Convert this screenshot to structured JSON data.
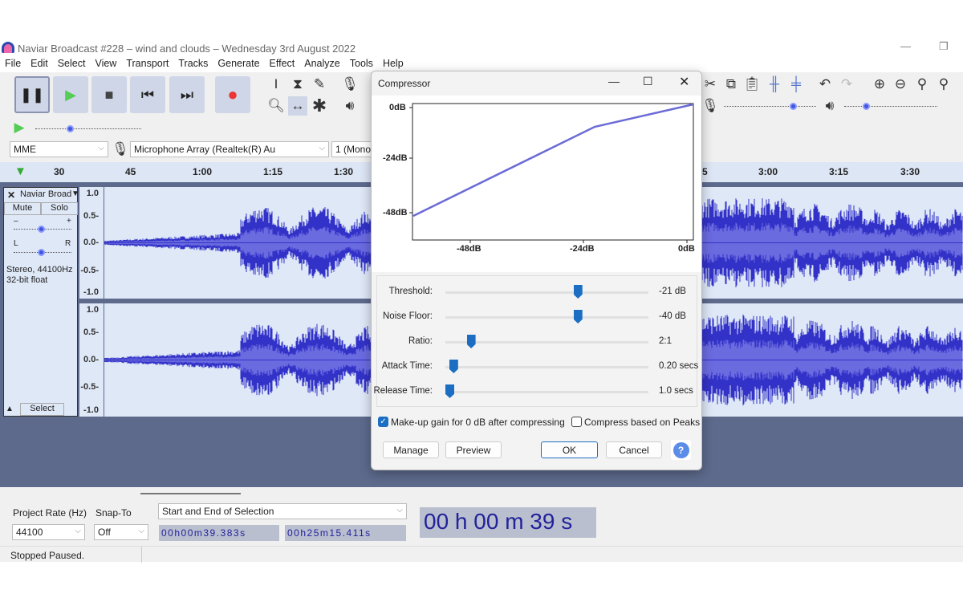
{
  "window": {
    "title": "Naviar Broadcast #228 – wind and clouds – Wednesday 3rd August 2022",
    "minimize": "—",
    "restore": "❐"
  },
  "menu": [
    "File",
    "Edit",
    "Select",
    "View",
    "Transport",
    "Tracks",
    "Generate",
    "Effect",
    "Analyze",
    "Tools",
    "Help"
  ],
  "transport": {
    "pause": "❚❚",
    "play": "▶",
    "stop": "■",
    "skip_start": "⏮",
    "skip_end": "⏭",
    "record": "●"
  },
  "devices": {
    "host": "MME",
    "input": "Microphone Array (Realtek(R) Au",
    "channels": "1 (Mono"
  },
  "ruler": {
    "ticks": [
      "30",
      "45",
      "1:00",
      "1:15",
      "1:30",
      "5",
      "3:00",
      "3:15",
      "3:30"
    ]
  },
  "track": {
    "name": "Naviar Broad",
    "mute": "Mute",
    "solo": "Solo",
    "gain_minus": "–",
    "gain_plus": "+",
    "pan_l": "L",
    "pan_r": "R",
    "info1": "Stereo, 44100Hz",
    "info2": "32-bit float",
    "select": "Select",
    "scale": [
      "1.0",
      "0.5-",
      "0.0-",
      "-0.5-",
      "-1.0"
    ]
  },
  "dialog": {
    "title": "Compressor",
    "graph": {
      "y_labels": [
        "0dB",
        "-24dB",
        "-48dB"
      ],
      "x_labels": [
        "-48dB",
        "-24dB",
        "0dB"
      ]
    },
    "params": [
      {
        "label": "Threshold:",
        "value": "-21 dB",
        "pos": 0.66
      },
      {
        "label": "Noise Floor:",
        "value": "-40 dB",
        "pos": 0.66
      },
      {
        "label": "Ratio:",
        "value": "2:1",
        "pos": 0.11
      },
      {
        "label": "Attack Time:",
        "value": "0.20 secs",
        "pos": 0.02
      },
      {
        "label": "Release Time:",
        "value": "1.0 secs",
        "pos": 0.0
      }
    ],
    "makeup": {
      "label": "Make-up gain for 0 dB after compressing",
      "checked": true
    },
    "peaks": {
      "label": "Compress based on Peaks",
      "checked": false
    },
    "manage": "Manage",
    "preview": "Preview",
    "ok": "OK",
    "cancel": "Cancel",
    "help": "?"
  },
  "bottom": {
    "rate_label": "Project Rate (Hz)",
    "rate": "44100",
    "snap_label": "Snap-To",
    "snap": "Off",
    "sel_mode": "Start and End of Selection",
    "sel_start": "00h00m39.383s",
    "sel_end": "00h25m15.411s",
    "time": "00 h 00 m 39 s"
  },
  "status": "Stopped Paused.",
  "colors": {
    "waveform": "#3232c8",
    "waveform_light": "#6b6be0",
    "accent": "#1b6ec2"
  }
}
